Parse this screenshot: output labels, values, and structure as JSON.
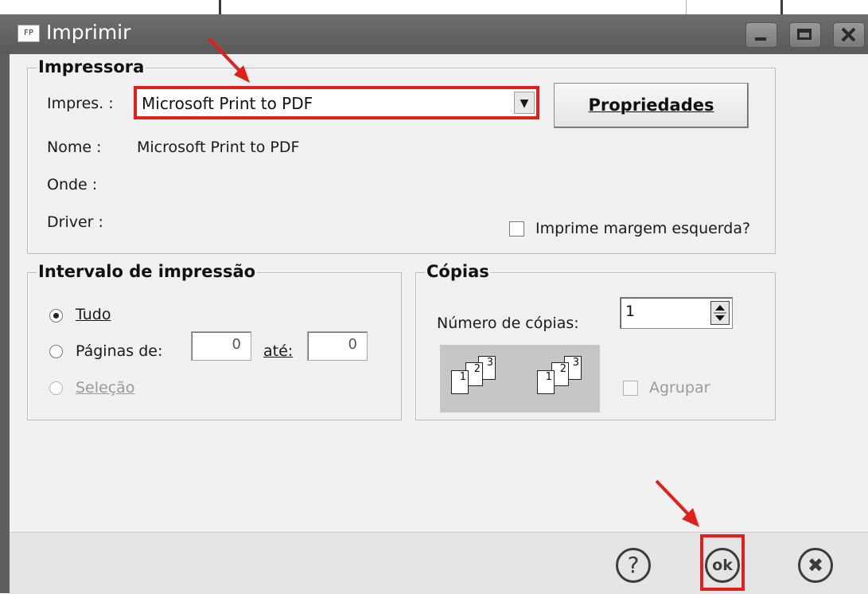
{
  "window": {
    "icon_text": "FP",
    "title": "Imprimir"
  },
  "impressora": {
    "legend": "Impressora",
    "impres_label": "Impres. :",
    "printer_selected": "Microsoft Print to PDF",
    "dropdown_arrow": "▼",
    "propriedades_label": "Propriedades",
    "nome_label": "Nome :",
    "nome_value": "Microsoft Print to PDF",
    "onde_label": "Onde :",
    "driver_label": "Driver :",
    "margem_checkbox_label": "Imprime margem esquerda?"
  },
  "intervalo": {
    "legend": "Intervalo de impressão",
    "tudo_label": "Tudo",
    "paginas_label": "Páginas de:",
    "de_value": "0",
    "ate_label": "até:",
    "ate_value": "0",
    "selecao_label": "Seleção"
  },
  "copias": {
    "legend": "Cópias",
    "numero_label": "Número de cópias:",
    "numero_value": "1",
    "agrupar_label": "Agrupar",
    "page_numbers": [
      "1",
      "2",
      "3"
    ]
  },
  "footer": {
    "help_glyph": "?",
    "ok_label": "ok",
    "cancel_glyph": "✖"
  },
  "colors": {
    "highlight": "#e0201b",
    "titlebar": "#606060"
  }
}
